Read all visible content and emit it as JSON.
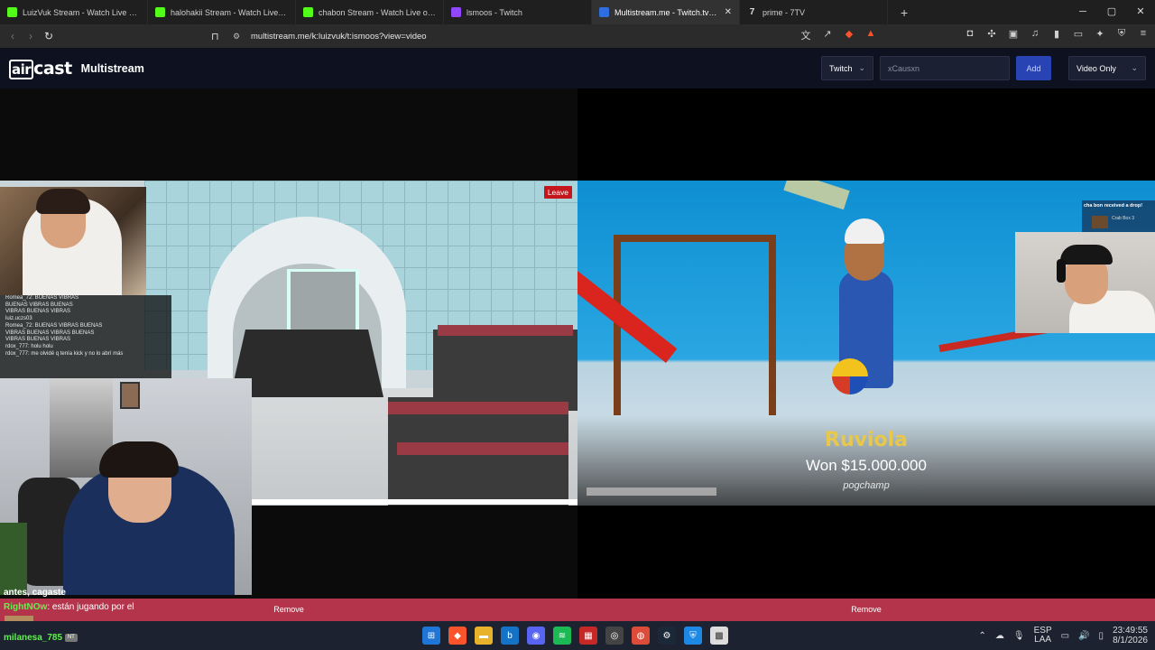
{
  "browser": {
    "tabs": [
      {
        "title": "LuizVuk Stream - Watch Live on Kick",
        "favicon": "kick-icon"
      },
      {
        "title": "halohakii Stream - Watch Live on Kick",
        "favicon": "kick-icon"
      },
      {
        "title": "chabon Stream - Watch Live on Kick",
        "favicon": "kick-icon"
      },
      {
        "title": "lsmoos - Twitch",
        "favicon": "twitch-icon"
      },
      {
        "title": "Multistream.me - Twitch.tv / Kick",
        "favicon": "multistream-icon"
      },
      {
        "title": "prime - 7TV",
        "favicon": "seventv-icon"
      }
    ],
    "active_tab": 4,
    "url": "multistream.me/k:luizvuk/t:ismoos?view=video"
  },
  "app": {
    "brand": "aircast",
    "brand_part1": "air",
    "brand_part2": "cast",
    "title": "Multistream",
    "platform_select": "Twitch",
    "channel_input": "xCausxn",
    "add_label": "Add",
    "view_select": "Video Only"
  },
  "streams": {
    "left": {
      "leave_label": "Leave",
      "remove_label": "Remove",
      "chat_lines": [
        "Romea_72: BUENAS VIBRAS",
        "BUENAS VIBRAS   BUENAS",
        "VIBRAS   BUENAS VIBRAS",
        "luiz.uczs03",
        "Romea_72: BUENAS VIBRAS   BUENAS",
        "VIBRAS   BUENAS VIBRAS   BUENAS",
        "VIBRAS   BUENAS VIBRAS",
        "rdox_777: holu holu",
        "rdox_777: me olvidé q tenía kick y no lo abrí más"
      ]
    },
    "right": {
      "remove_label": "Remove",
      "drop_text": "cha bon received a drop!",
      "drop_sub": "Crab Box 3",
      "winner_name": "Ruviola",
      "winner_text": "Won $15.000.000",
      "winner_sub": "pogchamp"
    }
  },
  "chat_overlay": {
    "line1": "antes, cagaste",
    "line2_user": "RightNOw",
    "line2_text": ": están jugando por el",
    "line3_user": "milanesa_785",
    "line3_emote": "NT"
  },
  "taskbar": {
    "lang": "ESP",
    "lang_sub": "LAA",
    "time": "23:49:55",
    "date": "8/1/2026"
  }
}
